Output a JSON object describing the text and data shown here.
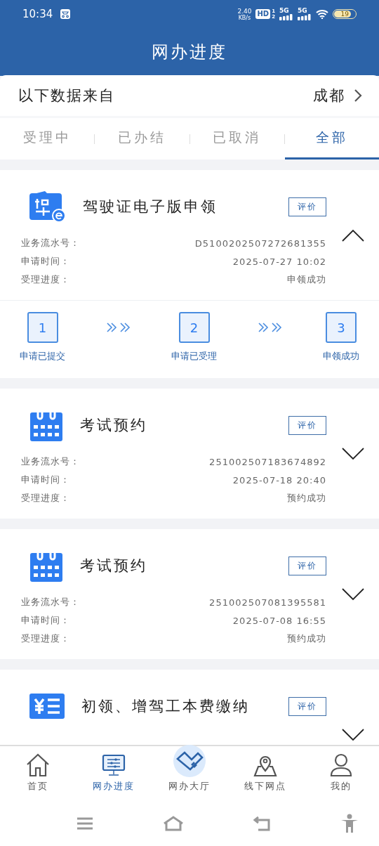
{
  "status_bar": {
    "time": "10:34",
    "speed": "2.40",
    "speed_unit": "KB/s",
    "hd": "HD",
    "sim_1": "1",
    "sim_2": "2",
    "network_1": "5G",
    "network_2": "5G",
    "battery": "19"
  },
  "header": {
    "title": "网办进度"
  },
  "source": {
    "label": "以下数据来自",
    "city": "成都"
  },
  "tabs": [
    {
      "label": "受理中",
      "selected": false
    },
    {
      "label": "已办结",
      "selected": false
    },
    {
      "label": "已取消",
      "selected": false
    },
    {
      "label": "全部",
      "selected": true
    }
  ],
  "records": [
    {
      "kind": "license",
      "title": "驾驶证电子版申领",
      "button": "评价",
      "expanded": true,
      "rows": [
        {
          "label": "业务流水号：",
          "value": "D5100202507272681355"
        },
        {
          "label": "申请时间：",
          "value": "2025-07-27 10:02"
        },
        {
          "label": "受理进度：",
          "value": "申领成功"
        }
      ],
      "steps": [
        {
          "number": "1",
          "label": "申请已提交"
        },
        {
          "number": "2",
          "label": "申请已受理"
        },
        {
          "number": "3",
          "label": "申领成功"
        }
      ]
    },
    {
      "kind": "calendar",
      "title": "考试预约",
      "button": "评价",
      "expanded": false,
      "rows": [
        {
          "label": "业务流水号：",
          "value": "251002507183674892"
        },
        {
          "label": "申请时间：",
          "value": "2025-07-18 20:40"
        },
        {
          "label": "受理进度：",
          "value": "预约成功"
        }
      ]
    },
    {
      "kind": "calendar",
      "title": "考试预约",
      "button": "评价",
      "expanded": false,
      "rows": [
        {
          "label": "业务流水号：",
          "value": "251002507081395581"
        },
        {
          "label": "申请时间：",
          "value": "2025-07-08 16:55"
        },
        {
          "label": "受理进度：",
          "value": "预约成功"
        }
      ]
    },
    {
      "kind": "fee",
      "title": "初领、增驾工本费缴纳",
      "button": "评价",
      "expanded": false
    }
  ],
  "bottom_nav": [
    {
      "kind": "home",
      "label": "首页",
      "selected": false
    },
    {
      "kind": "monitor",
      "label": "网办进度",
      "selected": true
    },
    {
      "kind": "hall",
      "label": "网办大厅",
      "selected": false
    },
    {
      "kind": "map",
      "label": "线下网点",
      "selected": false
    },
    {
      "kind": "person",
      "label": "我的",
      "selected": false
    }
  ]
}
